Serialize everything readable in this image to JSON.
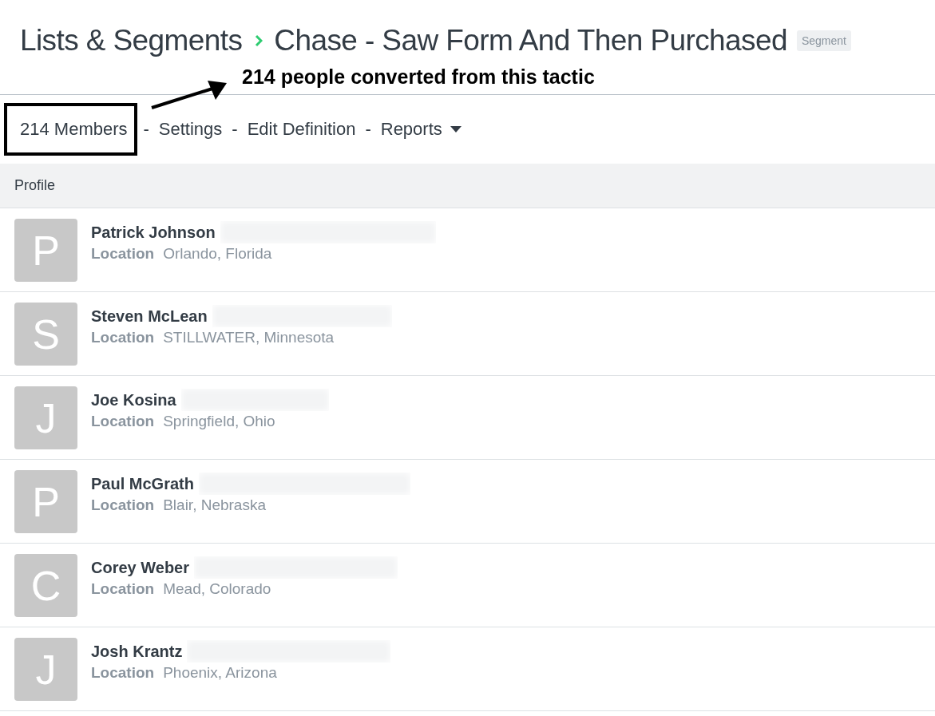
{
  "breadcrumb": {
    "parent": "Lists & Segments",
    "current": "Chase - Saw Form And Then Purchased",
    "badge": "Segment"
  },
  "annotation": {
    "text": "214 people converted from this tactic"
  },
  "nav": [
    {
      "label": "214 Members",
      "kind": "link",
      "highlighted": true
    },
    {
      "label": "Settings",
      "kind": "link",
      "highlighted": false
    },
    {
      "label": "Edit Definition",
      "kind": "link",
      "highlighted": false
    },
    {
      "label": "Reports",
      "kind": "dropdown",
      "highlighted": false
    }
  ],
  "nav_separator": "-",
  "table": {
    "columns": [
      "Profile"
    ],
    "rows": [
      {
        "initial": "P",
        "name": "Patrick Johnson",
        "location_label": "Location",
        "location": "Orlando, Florida"
      },
      {
        "initial": "S",
        "name": "Steven McLean",
        "location_label": "Location",
        "location": "STILLWATER, Minnesota"
      },
      {
        "initial": "J",
        "name": "Joe Kosina",
        "location_label": "Location",
        "location": "Springfield, Ohio"
      },
      {
        "initial": "P",
        "name": "Paul McGrath",
        "location_label": "Location",
        "location": "Blair, Nebraska"
      },
      {
        "initial": "C",
        "name": "Corey Weber",
        "location_label": "Location",
        "location": "Mead, Colorado"
      },
      {
        "initial": "J",
        "name": "Josh Krantz",
        "location_label": "Location",
        "location": "Phoenix, Arizona"
      }
    ]
  }
}
